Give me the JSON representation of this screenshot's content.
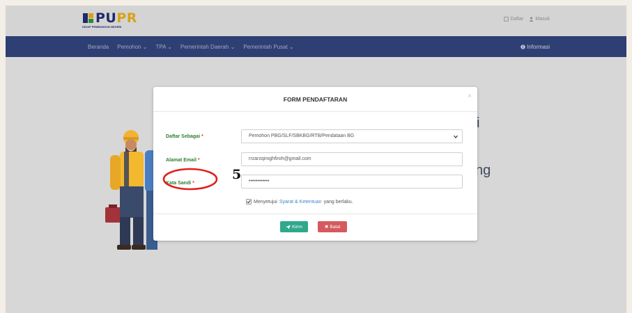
{
  "header": {
    "logo_text_pu": "PU",
    "logo_text_pr": "PR",
    "logo_subtitle": "DIGAP PEMBANGUN NEGERI",
    "links": [
      {
        "icon": "register-icon",
        "label": "Daftar"
      },
      {
        "icon": "user-icon",
        "label": "Masuk"
      }
    ]
  },
  "navbar": {
    "items": [
      {
        "label": "Beranda",
        "dropdown": false
      },
      {
        "label": "Pemohon",
        "dropdown": true
      },
      {
        "label": "TPA",
        "dropdown": true
      },
      {
        "label": "Pemerintah Daerah",
        "dropdown": true
      },
      {
        "label": "Pemerintah Pusat",
        "dropdown": true
      }
    ],
    "info_label": "Informasi",
    "info_icon": "info-icon"
  },
  "background": {
    "text_fragment_1": "i",
    "text_fragment_2": "ng"
  },
  "modal": {
    "title": "FORM PENDAFTARAN",
    "close_icon": "close-icon",
    "fields": [
      {
        "label": "Daftar Sebagai",
        "required": "*",
        "type": "select",
        "value": "Pemohon PBG/SLF/SBKBG/RTB/Pendataan BG"
      },
      {
        "label": "Alamat Email",
        "required": "*",
        "type": "email",
        "value": "rrzarzqimghfiroh@gmail.com"
      },
      {
        "label": "Kata Sandi",
        "required": "*",
        "type": "password",
        "value": "••••••••••••"
      }
    ],
    "agreement": {
      "prefix": "Menyetujui",
      "link": "Syarat & Ketentuan",
      "suffix": "yang berlaku.",
      "checked": true
    },
    "buttons": {
      "submit_label": "Kirim",
      "submit_icon": "send-icon",
      "cancel_label": "Batal",
      "cancel_icon": "times-icon"
    }
  },
  "annotation": {
    "step_number": "5",
    "highlight_color": "#e0201c"
  },
  "colors": {
    "navbar": "#2e3f73",
    "label_green": "#2f7d32",
    "required_red": "#e53935",
    "submit": "#2fa88b",
    "cancel": "#d55a5f",
    "link": "#3e86c6"
  }
}
